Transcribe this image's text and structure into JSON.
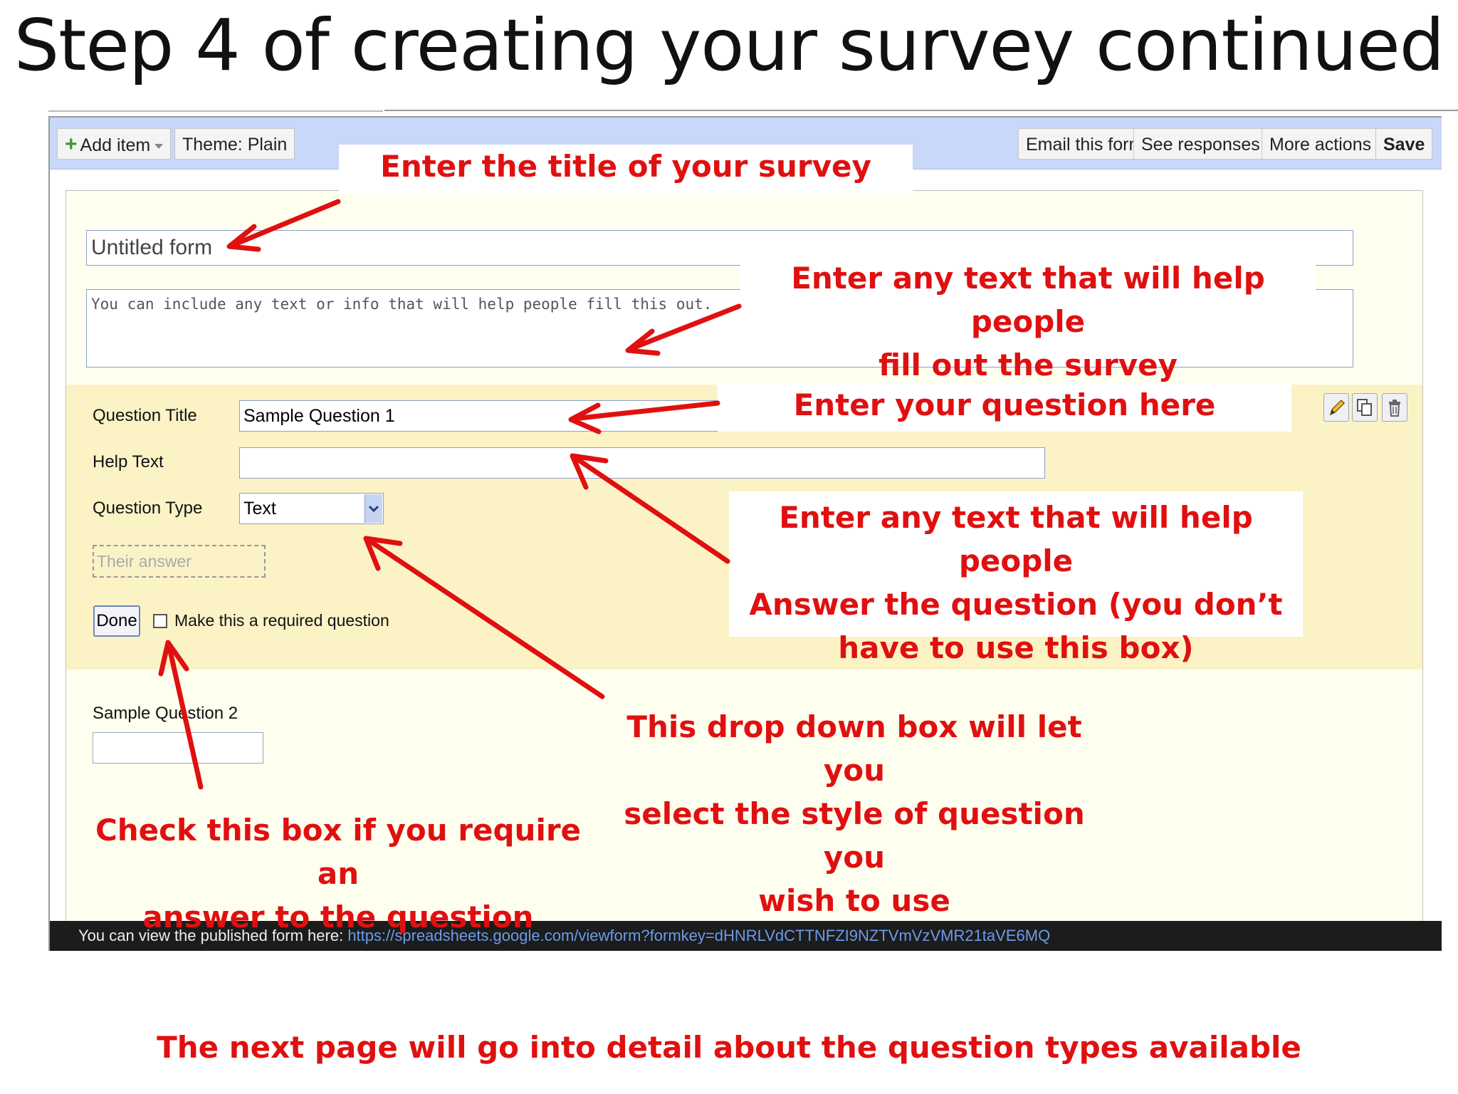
{
  "slide_title": "Step 4 of creating your survey continued",
  "toolbar": {
    "add_item": "Add item",
    "theme": "Theme:  Plain",
    "email_form": "Email this form",
    "see_responses": "See responses",
    "more_actions": "More actions",
    "save": "Save"
  },
  "form": {
    "title_value": "Untitled form",
    "description_placeholder": "You can include any text or info that will help people fill this out."
  },
  "question": {
    "title_label": "Question Title",
    "title_value": "Sample Question 1",
    "help_label": "Help Text",
    "help_value": "",
    "type_label": "Question Type",
    "type_value": "Text",
    "answer_placeholder": "Their answer",
    "done": "Done",
    "required_label": "Make this a required question"
  },
  "question2": {
    "title": "Sample Question 2"
  },
  "status": {
    "prefix": "You can view the published form here: ",
    "url": "https://spreadsheets.google.com/viewform?formkey=dHNRLVdCTTNFZI9NZTVmVzVMR21taVE6MQ"
  },
  "callouts": {
    "title": "Enter the title of your survey",
    "description_1": "Enter any text that will help people",
    "description_2": "fill out the survey",
    "question": "Enter your question here",
    "help_1": "Enter any text that will help people",
    "help_2": "Answer the question (you don’t",
    "help_3": "have to use this box)",
    "dropdown_1": "This drop down box will let you",
    "dropdown_2": "select the style of question you",
    "dropdown_3": "wish to use",
    "required_1": "Check this box if you require an",
    "required_2": "answer to the question"
  },
  "footer_note": "The next page will go into detail about the question types available",
  "colors": {
    "annotation": "#e01010",
    "toolbar": "#c9d7f8",
    "question_panel": "#fbf3c6"
  },
  "icons": [
    "plus-icon",
    "dropdown-arrow-icon",
    "pencil-icon",
    "duplicate-icon",
    "trash-icon"
  ]
}
